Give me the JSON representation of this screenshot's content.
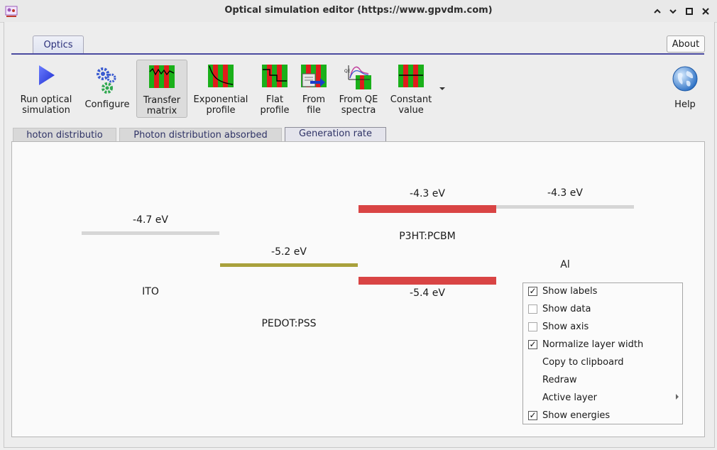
{
  "window": {
    "title": "Optical simulation editor (https://www.gpvdm.com)"
  },
  "ribbon": {
    "tab_label": "Optics",
    "about_label": "About",
    "buttons": [
      {
        "line1": "Run optical",
        "line2": "simulation",
        "icon": "play-icon"
      },
      {
        "line1": "Configure",
        "line2": "",
        "icon": "gears-icon"
      },
      {
        "line1": "Transfer",
        "line2": "matrix",
        "icon": "transfer-matrix-icon"
      },
      {
        "line1": "Exponential",
        "line2": "profile",
        "icon": "exponential-profile-icon"
      },
      {
        "line1": "Flat",
        "line2": "profile",
        "icon": "flat-profile-icon"
      },
      {
        "line1": "From",
        "line2": "file",
        "icon": "from-file-icon"
      },
      {
        "line1": "From QE",
        "line2": "spectra",
        "icon": "qe-spectra-icon"
      },
      {
        "line1": "Constant",
        "line2": "value",
        "icon": "constant-value-icon"
      },
      {
        "line1": "Help",
        "line2": "",
        "icon": "globe-icon"
      }
    ]
  },
  "tabs": [
    {
      "label": "hoton distributio"
    },
    {
      "label": "Photon distribution absorbed"
    },
    {
      "label": "Generation rate"
    }
  ],
  "diagram": {
    "layers": [
      {
        "name": "ITO",
        "top_energy_label": "-4.7 eV",
        "color": "#d6d6d6"
      },
      {
        "name": "PEDOT:PSS",
        "top_energy_label": "-5.2 eV",
        "color": "#a9a13c"
      },
      {
        "name": "P3HT:PCBM",
        "top_energy_label": "-4.3 eV",
        "bottom_energy_label": "-5.4 eV",
        "color": "#d94444"
      },
      {
        "name": "Al",
        "top_energy_label": "-4.3 eV",
        "color": "#d6d6d6"
      }
    ]
  },
  "context_menu": {
    "items": [
      {
        "label": "Show labels",
        "checkable": true,
        "checked": true
      },
      {
        "label": "Show data",
        "checkable": true,
        "checked": false
      },
      {
        "label": "Show axis",
        "checkable": true,
        "checked": false
      },
      {
        "label": "Normalize layer width",
        "checkable": true,
        "checked": true
      },
      {
        "label": "Copy to clipboard",
        "checkable": false
      },
      {
        "label": "Redraw",
        "checkable": false
      },
      {
        "label": "Active layer",
        "checkable": false,
        "submenu": true
      },
      {
        "label": "Show energies",
        "checkable": true,
        "checked": true
      }
    ]
  }
}
